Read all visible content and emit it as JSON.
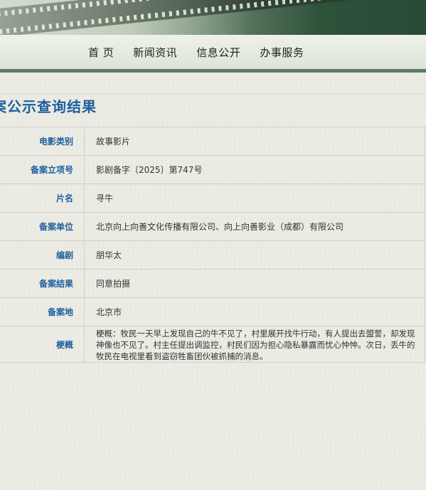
{
  "nav": {
    "items": [
      "首 页",
      "新闻资讯",
      "信息公开",
      "办事服务"
    ]
  },
  "page_title": "案公示查询结果",
  "record": {
    "rows": [
      {
        "label": "电影类别",
        "value": "故事影片"
      },
      {
        "label": "备案立项号",
        "value": "影剧备字〔2025〕第747号"
      },
      {
        "label": "片名",
        "value": "寻牛"
      },
      {
        "label": "备案单位",
        "value": "北京向上向善文化传播有限公司、向上向善影业（成都）有限公司"
      },
      {
        "label": "编剧",
        "value": "朋华太"
      },
      {
        "label": "备案结果",
        "value": "同意拍摄"
      },
      {
        "label": "备案地",
        "value": "北京市"
      },
      {
        "label": "梗概",
        "value": "梗概：牧民一天早上发现自己的牛不见了，村里展开找牛行动，有人提出去盟誓，却发现神像也不见了。村主任提出调监控，村民们因为担心隐私暴露而忧心忡忡。次日，丢牛的牧民在电视里看到盗窃牲畜团伙被抓捕的消息。"
      }
    ]
  },
  "colors": {
    "accent_blue": "#1e5f9e",
    "nav_bar_green": "#5c7b67",
    "banner_dark_green": "#2f523b"
  }
}
